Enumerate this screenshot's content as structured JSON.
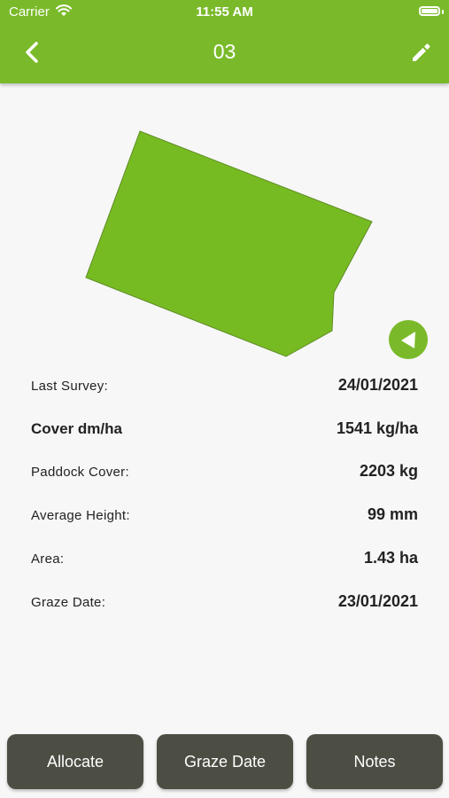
{
  "status_bar": {
    "carrier": "Carrier",
    "time": "11:55 AM"
  },
  "nav": {
    "title": "03"
  },
  "details": [
    {
      "label": "Last Survey:",
      "value": "24/01/2021"
    },
    {
      "label": "Cover dm/ha",
      "value": "1541 kg/ha"
    },
    {
      "label": "Paddock Cover:",
      "value": "2203 kg"
    },
    {
      "label": "Average Height:",
      "value": "99 mm"
    },
    {
      "label": "Area:",
      "value": "1.43 ha"
    },
    {
      "label": "Graze Date:",
      "value": "23/01/2021"
    }
  ],
  "buttons": {
    "allocate": "Allocate",
    "graze_date": "Graze Date",
    "notes": "Notes"
  },
  "colors": {
    "brand_green": "#7aba2a",
    "paddock_fill": "#77bb22",
    "button_dark": "#4d4e43",
    "background": "#f7f7f7"
  },
  "icons": [
    "wifi-icon",
    "battery-icon",
    "back-chevron-icon",
    "pencil-icon",
    "paddock-shape",
    "navigate-arrow-icon"
  ]
}
